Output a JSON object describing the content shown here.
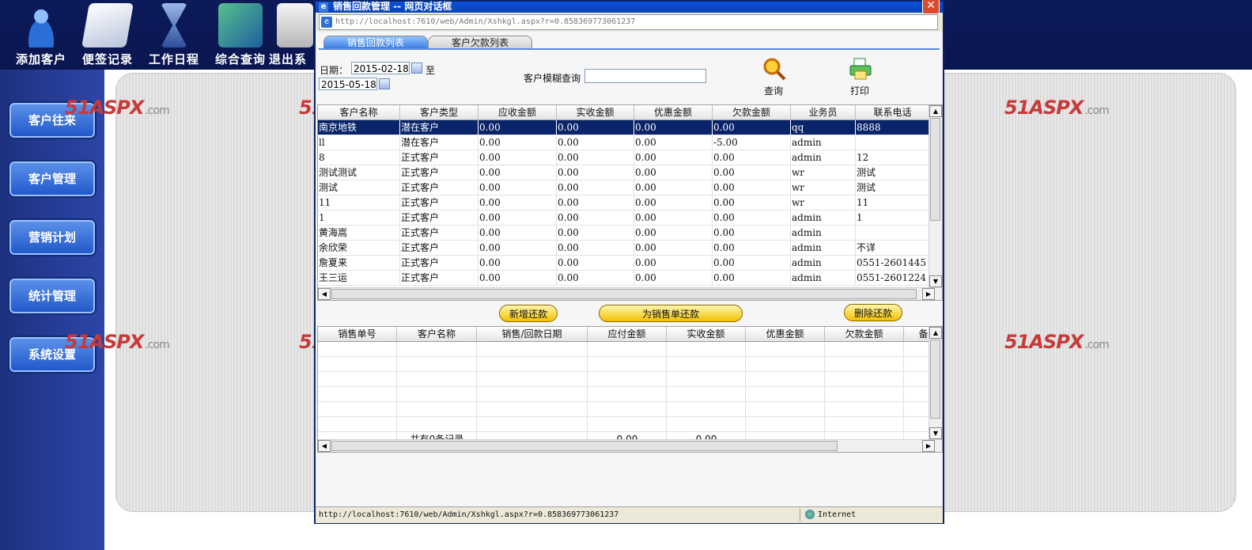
{
  "toolbar": {
    "items": [
      {
        "label": "添加客户",
        "icon": "user-add-icon",
        "color": "#4a8fe0"
      },
      {
        "label": "便签记录",
        "icon": "notebook-icon",
        "color": "#cfd6e6"
      },
      {
        "label": "工作日程",
        "icon": "hourglass-icon",
        "color": "#5e86c9"
      },
      {
        "label": "综合查询",
        "icon": "abc-book-icon",
        "color": "#3b8c6a"
      },
      {
        "label": "退出系",
        "icon": "sofa-icon",
        "color": "#dcdcdc"
      }
    ]
  },
  "sidebar": {
    "items": [
      {
        "label": "客户往来"
      },
      {
        "label": "客户管理"
      },
      {
        "label": "营销计划"
      },
      {
        "label": "统计管理"
      },
      {
        "label": "系统设置"
      }
    ]
  },
  "watermark": {
    "brand": "51ASPX",
    "suffix": ".com",
    "color": "#c73a3a"
  },
  "dialog": {
    "title": "销售回款管理 -- 网页对话框",
    "url": "http://localhost:7610/web/Admin/Xshkgl.aspx?r=0.858369773061237",
    "tabs": [
      {
        "label": "销售回款列表",
        "active": true
      },
      {
        "label": "客户欠款列表",
        "active": false
      }
    ],
    "filter": {
      "date_label": "日期：",
      "date_from": "2015-02-18",
      "to_label": "至",
      "date_to": "2015-05-18",
      "customer_search_label": "客户模糊查询",
      "customer_search_value": "",
      "query_label": "查询",
      "print_label": "打印"
    },
    "upper_grid": {
      "columns": [
        "客户名称",
        "客户类型",
        "应收金额",
        "实收金额",
        "优惠金额",
        "欠款金额",
        "业务员",
        "联系电话"
      ],
      "rows": [
        [
          "南京地铁",
          "潜在客户",
          "0.00",
          "0.00",
          "0.00",
          "0.00",
          "qq",
          "8888"
        ],
        [
          "ll",
          "潜在客户",
          "0.00",
          "0.00",
          "0.00",
          "-5.00",
          "admin",
          ""
        ],
        [
          "8",
          "正式客户",
          "0.00",
          "0.00",
          "0.00",
          "0.00",
          "admin",
          "12"
        ],
        [
          "测试测试",
          "正式客户",
          "0.00",
          "0.00",
          "0.00",
          "0.00",
          "wr",
          "测试"
        ],
        [
          "测试",
          "正式客户",
          "0.00",
          "0.00",
          "0.00",
          "0.00",
          "wr",
          "测试"
        ],
        [
          "11",
          "正式客户",
          "0.00",
          "0.00",
          "0.00",
          "0.00",
          "wr",
          "11"
        ],
        [
          "1",
          "正式客户",
          "0.00",
          "0.00",
          "0.00",
          "0.00",
          "admin",
          "1"
        ],
        [
          "黄海嵩",
          "正式客户",
          "0.00",
          "0.00",
          "0.00",
          "0.00",
          "admin",
          ""
        ],
        [
          "余欣荣",
          "正式客户",
          "0.00",
          "0.00",
          "0.00",
          "0.00",
          "admin",
          "不详"
        ],
        [
          "詹夏来",
          "正式客户",
          "0.00",
          "0.00",
          "0.00",
          "0.00",
          "admin",
          "0551-2601445"
        ],
        [
          "王三运",
          "正式客户",
          "0.00",
          "0.00",
          "0.00",
          "0.00",
          "admin",
          "0551-2601224"
        ]
      ],
      "selected_row": 0
    },
    "actions": {
      "add_payment": "新增还款",
      "pay_for_order": "为销售单还款",
      "delete_payment": "删除还款"
    },
    "lower_grid": {
      "columns": [
        "销售单号",
        "客户名称",
        "销售/回款日期",
        "应付金额",
        "实收金额",
        "优惠金额",
        "欠款金额",
        "备"
      ],
      "footer": [
        "",
        "共有0条记录",
        "",
        "0.00",
        "0.00",
        "",
        "",
        ""
      ]
    },
    "status": {
      "url": "http://localhost:7610/web/Admin/Xshkgl.aspx?r=0.858369773061237",
      "zone": "Internet"
    }
  }
}
